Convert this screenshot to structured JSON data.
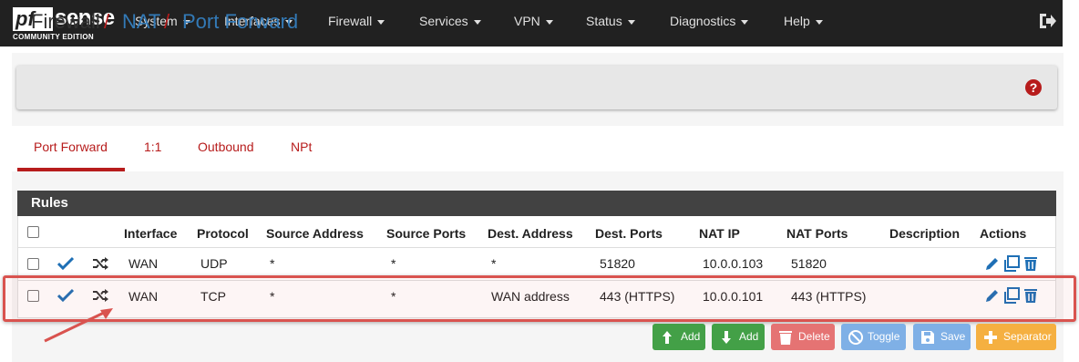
{
  "brand": {
    "logo_pf": "pf",
    "logo_sense": "sense",
    "edition": "COMMUNITY EDITION"
  },
  "nav": {
    "items": [
      {
        "label": "System"
      },
      {
        "label": "Interfaces"
      },
      {
        "label": "Firewall"
      },
      {
        "label": "Services"
      },
      {
        "label": "VPN"
      },
      {
        "label": "Status"
      },
      {
        "label": "Diagnostics"
      },
      {
        "label": "Help"
      }
    ],
    "logout_icon": "sign-out-icon"
  },
  "breadcrumb": {
    "root": "Firewall",
    "sep": "/",
    "section": "NAT",
    "page": "Port Forward",
    "help_icon": "question-circle-icon",
    "help_glyph": "?"
  },
  "tabs": [
    {
      "label": "Port Forward",
      "active": true
    },
    {
      "label": "1:1"
    },
    {
      "label": "Outbound"
    },
    {
      "label": "NPt"
    }
  ],
  "rules": {
    "title": "Rules",
    "columns": [
      "Interface",
      "Protocol",
      "Source Address",
      "Source Ports",
      "Dest. Address",
      "Dest. Ports",
      "NAT IP",
      "NAT Ports",
      "Description",
      "Actions"
    ],
    "rows": [
      {
        "interface": "WAN",
        "protocol": "UDP",
        "src_addr": "*",
        "src_ports": "*",
        "dst_addr": "*",
        "dst_ports": "51820",
        "nat_ip": "10.0.0.103",
        "nat_ports": "51820",
        "description": "",
        "enabled_icon": "check-icon",
        "type_icon": "random-icon"
      },
      {
        "interface": "WAN",
        "protocol": "TCP",
        "src_addr": "*",
        "src_ports": "*",
        "dst_addr": "WAN address",
        "dst_ports": "443 (HTTPS)",
        "nat_ip": "10.0.0.101",
        "nat_ports": "443 (HTTPS)",
        "description": "",
        "enabled_icon": "check-icon",
        "type_icon": "random-icon"
      }
    ],
    "action_icons": [
      "pencil-icon",
      "copy-icon",
      "trash-icon"
    ]
  },
  "buttons": {
    "add_top": "Add",
    "add_bottom": "Add",
    "delete": "Delete",
    "toggle": "Toggle",
    "save": "Save",
    "separator": "Separator"
  },
  "colors": {
    "navbar": "#212121",
    "accent_red": "#b71c1c",
    "link_blue": "#337ab7",
    "btn_green": "#43a047",
    "btn_red": "#e57373",
    "btn_blue": "#7fb0e6",
    "btn_orange": "#f5b041",
    "highlight": "#d9534f"
  }
}
